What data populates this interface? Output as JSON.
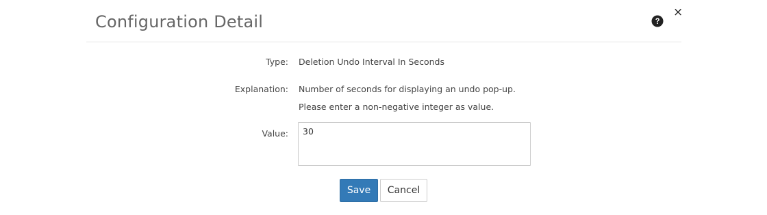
{
  "dialog": {
    "title": "Configuration Detail",
    "help_icon": "question-circle-icon",
    "close_icon": "close-icon",
    "close_glyph": "×"
  },
  "form": {
    "type": {
      "label": "Type:",
      "value": "Deletion Undo Interval In Seconds"
    },
    "explanation": {
      "label": "Explanation:",
      "lines": [
        "Number of seconds for displaying an undo pop-up.",
        "Please enter a non-negative integer as value."
      ]
    },
    "value": {
      "label": "Value:",
      "current": "30"
    }
  },
  "actions": {
    "save_label": "Save",
    "cancel_label": "Cancel"
  },
  "colors": {
    "primary": "#337ab7",
    "title": "#666666",
    "border": "#cccccc"
  }
}
